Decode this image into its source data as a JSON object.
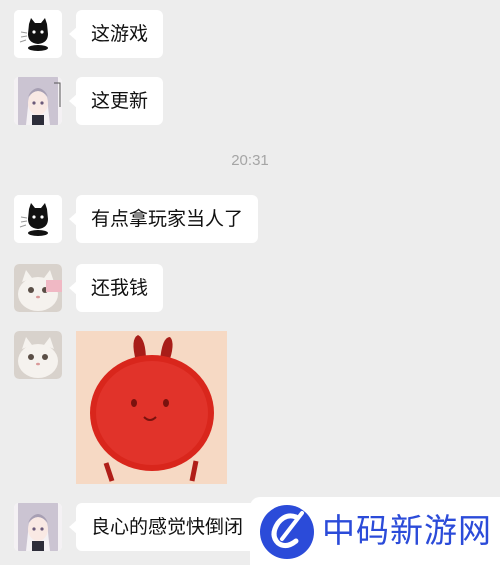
{
  "messages": [
    {
      "avatar": "black-cat-avatar",
      "text": "这游戏"
    },
    {
      "avatar": "anime-girl-avatar",
      "text": "这更新"
    },
    {
      "avatar": "black-cat-avatar",
      "text": "有点拿玩家当人了"
    },
    {
      "avatar": "white-cat-avatar",
      "text": "还我钱"
    },
    {
      "avatar": "white-cat-avatar",
      "sticker": "red-bunny-sticker"
    },
    {
      "avatar": "anime-girl-avatar",
      "text": "良心的感觉快倒闭"
    }
  ],
  "timestamp": "20:31",
  "watermark": {
    "logo": "blue-circle-c-logo",
    "text": "中码新游网"
  },
  "colors": {
    "background": "#ededed",
    "bubble": "#ffffff",
    "watermark_text": "#2b4bd9",
    "sticker_red": "#d9261c"
  }
}
